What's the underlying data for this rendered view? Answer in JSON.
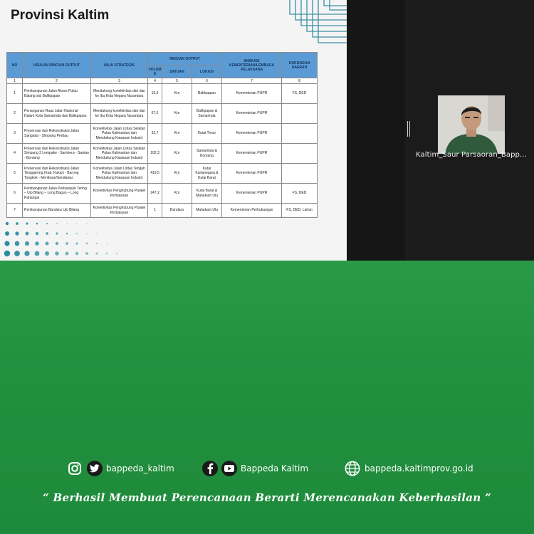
{
  "slide": {
    "title": "Provinsi Kaltim",
    "table": {
      "headers": {
        "no": "NO",
        "usulan": "USULAN RINCIAN OUTPUT",
        "nilai": "NILAI STRATEGIS",
        "rincian_output": "RINCIAN OUTPUT",
        "indikasi": "INDIKASI KEMENTERIAN/LEMBAGA PELAKSANA",
        "dukungan": "DUKUNGAN DAERAH",
        "volume": "VOLUM E",
        "satuan": "SATUAN",
        "lokasi": "LOKASI"
      },
      "column_numbers": [
        "1",
        "2",
        "3",
        "4",
        "5",
        "6",
        "7",
        "8"
      ],
      "rows": [
        {
          "no": "1",
          "usulan": "Pembangunan Jalan Akses Pulau Balang sisi Balikpapan",
          "nilai": "Mendukung konektivitas dari dan ke Ibu Kota Negara Nusantara",
          "volume": "15,5",
          "satuan": "Km",
          "lokasi": "Balikpapan",
          "kementerian": "Kementerian PUPR",
          "dukungan": "FS, DED"
        },
        {
          "no": "2",
          "usulan": "Penanganan Ruas Jalan Nasional Dalam Kota Samarinda dan Balikpapan",
          "nilai": "Mendukung konektivitas dari dan ke Ibu Kota Negara Nusantara",
          "volume": "67,5",
          "satuan": "Km",
          "lokasi": "Balikpapan & Samarinda",
          "kementerian": "Kementerian PUPR",
          "dukungan": ""
        },
        {
          "no": "3",
          "usulan": "Preservasi dan Rekonstruksi Jalan Sangatta - Simpang Perdau",
          "nilai": "Konektivitas Jalan Lintas Selatan Pulau Kalimantan dan Mendukung Kawasan Industri",
          "volume": "32,7",
          "satuan": "Km",
          "lokasi": "Kutai Timur",
          "kementerian": "Kementerian PUPR",
          "dukungan": ""
        },
        {
          "no": "4",
          "usulan": "Preservasi dan Rekonstruksi Jalan Simpang 3 Lempake - Sambera - Santan - Bontang",
          "nilai": "Konektivitas Jalan Lintas Selatan Pulau Kalimantan dan Mendukung Kawasan Industri",
          "volume": "102,3",
          "satuan": "Km",
          "lokasi": "Samarinda & Bontang",
          "kementerian": "Kementerian PUPR",
          "dukungan": ""
        },
        {
          "no": "5",
          "usulan": "Preservasi dan Rekonstruksi Jalan Tenggarong (Kab. Kukar) - Barong Tongkok - Mentiwan/Sendawar",
          "nilai": "Konektivitas Jalan Lintas Tengah Pulau Kalimantan dan Mendukung Kawasan Industri",
          "volume": "419,5",
          "satuan": "Km",
          "lokasi": "Kutai Kartanegara & Kutai Barat",
          "kementerian": "Kementerian PUPR",
          "dukungan": ""
        },
        {
          "no": "6",
          "usulan": "Pembangunan Jalan Perbatasan Tering – Ujo Bilang – Long Bagun – Long Pahangai",
          "nilai": "Konektivitas Penghubung Paralel Perbatasan",
          "volume": "247,2",
          "satuan": "Km",
          "lokasi": "Kutai Barat & Mahakam Ulu",
          "kementerian": "Kementerian PUPR",
          "dukungan": "FS, DED"
        },
        {
          "no": "7",
          "usulan": "Pembangunan Bandara Ujo Bilang",
          "nilai": "Konektivitas Penghubung Paralel Perbatasan",
          "volume": "1",
          "satuan": "Bandara",
          "lokasi": "Mahakam Ulu",
          "kementerian": "Kementerian Perhubungan",
          "dukungan": "FS, DED, Lahan"
        }
      ]
    }
  },
  "participant": {
    "name": "Kaltim_Saur Parsaoran_Bapp..."
  },
  "footer": {
    "instagram_twitter_handle": "bappeda_kaltim",
    "facebook_youtube_handle": "Bappeda Kaltim",
    "website": "bappeda.kaltimprov.go.id",
    "tagline": "“ Berhasil  Membuat Perencanaan Berarti Merencanakan Keberhasilan ”",
    "icons": [
      "instagram-icon",
      "twitter-icon",
      "facebook-icon",
      "youtube-icon",
      "globe-icon"
    ]
  },
  "colors": {
    "footer_green": "#22903f",
    "table_header_blue": "#5b9bd5",
    "slide_background": "#f4f4f4",
    "decoration_teal": "#1f7a8c"
  }
}
